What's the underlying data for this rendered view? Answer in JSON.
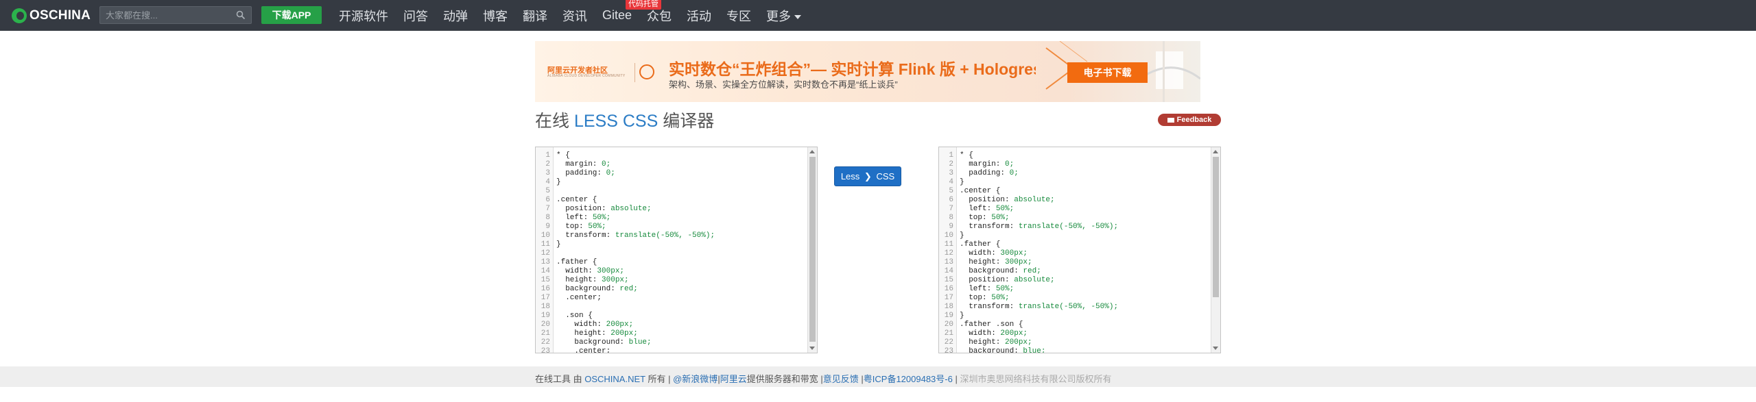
{
  "topnav": {
    "logo_text": "OSCHINA",
    "search_placeholder": "大家都在搜...",
    "app_button": "下载APP",
    "items": [
      {
        "label": "开源软件"
      },
      {
        "label": "问答"
      },
      {
        "label": "动弹"
      },
      {
        "label": "博客"
      },
      {
        "label": "翻译"
      },
      {
        "label": "资讯"
      },
      {
        "label": "Gitee",
        "badge": "代码托管"
      },
      {
        "label": "众包"
      },
      {
        "label": "活动"
      },
      {
        "label": "专区"
      },
      {
        "label": "更多"
      }
    ]
  },
  "banner": {
    "org": "阿里云开发者社区",
    "org_sub": "ALIBABA CLOUD DEVELOPER COMMUNITY",
    "title": "实时数仓“王炸组合”— 实时计算 Flink 版 + Hologres",
    "subtitle": "架构、场景、实操全方位解读，实时数仓不再是“纸上谈兵”",
    "button": "电子书下载"
  },
  "page": {
    "title_pre": "在线",
    "title_hl": "LESS CSS",
    "title_post": "编译器",
    "feedback": "Feedback"
  },
  "convert": {
    "left": "Less",
    "right": "CSS"
  },
  "less_lines": [
    "* {",
    "  margin: 0;",
    "  padding: 0;",
    "}",
    "",
    ".center {",
    "  position: absolute;",
    "  left: 50%;",
    "  top: 50%;",
    "  transform: translate(-50%, -50%);",
    "}",
    "",
    ".father {",
    "  width: 300px;",
    "  height: 300px;",
    "  background: red;",
    "  .center;",
    "",
    "  .son {",
    "    width: 200px;",
    "    height: 200px;",
    "    background: blue;",
    "    .center;"
  ],
  "css_lines": [
    "* {",
    "  margin: 0;",
    "  padding: 0;",
    "}",
    ".center {",
    "  position: absolute;",
    "  left: 50%;",
    "  top: 50%;",
    "  transform: translate(-50%, -50%);",
    "}",
    ".father {",
    "  width: 300px;",
    "  height: 300px;",
    "  background: red;",
    "  position: absolute;",
    "  left: 50%;",
    "  top: 50%;",
    "  transform: translate(-50%, -50%);",
    "}",
    ".father .son {",
    "  width: 200px;",
    "  height: 200px;",
    "  background: blue;"
  ],
  "footer": {
    "prefix": "在线工具 由",
    "site": "OSCHINA.NET",
    "owned": "所有 |",
    "weibo": "@新浪微博",
    "sep1": "|",
    "aliyun": "阿里云",
    "service": "提供服务器和带宽",
    "sep2": "|",
    "feedback": "意见反馈",
    "sep3": "|",
    "icp": "粤ICP备12009483号-6",
    "sep4": "|",
    "company": "深圳市奥思网络科技有限公司版权所有"
  },
  "colors": {
    "nav_bg": "#353a42",
    "app_button": "#26a047",
    "accent_blue": "#2b7cc5",
    "banner_orange": "#ea6b1a",
    "feedback_red": "#b13c33"
  }
}
